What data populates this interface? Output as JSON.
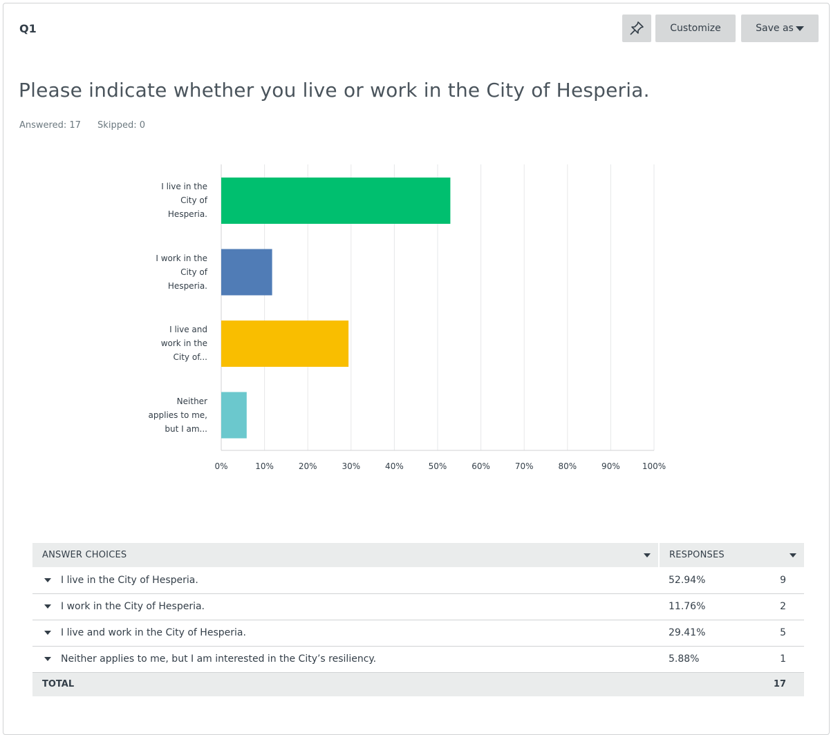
{
  "question": {
    "id": "Q1",
    "title": "Please indicate whether you live or work in the City of Hesperia.",
    "answered": "Answered: 17",
    "skipped": "Skipped: 0"
  },
  "toolbar": {
    "pin_icon": "pin-icon",
    "customize_label": "Customize",
    "saveas_label": "Save as"
  },
  "chart_data": {
    "type": "bar",
    "orientation": "horizontal",
    "categories": [
      "I live in the\nCity of\nHesperia.",
      "I work in the\nCity of\nHesperia.",
      "I live and\nwork in the\nCity of...",
      "Neither\napplies to me,\nbut I am..."
    ],
    "values": [
      52.94,
      11.76,
      29.41,
      5.88
    ],
    "colors": [
      "#00bf6f",
      "#507cb6",
      "#f9be00",
      "#6bc8cd"
    ],
    "xlim": [
      0,
      100
    ],
    "xticks": [
      "0%",
      "10%",
      "20%",
      "30%",
      "40%",
      "50%",
      "60%",
      "70%",
      "80%",
      "90%",
      "100%"
    ],
    "grid": true
  },
  "table": {
    "headers": {
      "choices": "ANSWER CHOICES",
      "responses": "RESPONSES"
    },
    "rows": [
      {
        "label": "I live in the City of Hesperia.",
        "percent": "52.94%",
        "count": "9"
      },
      {
        "label": "I work in the City of Hesperia.",
        "percent": "11.76%",
        "count": "2"
      },
      {
        "label": "I live and work in the City of Hesperia.",
        "percent": "29.41%",
        "count": "5"
      },
      {
        "label": "Neither applies to me, but I am interested in the City’s resiliency.",
        "percent": "5.88%",
        "count": "1"
      }
    ],
    "total_label": "TOTAL",
    "total_count": "17"
  }
}
